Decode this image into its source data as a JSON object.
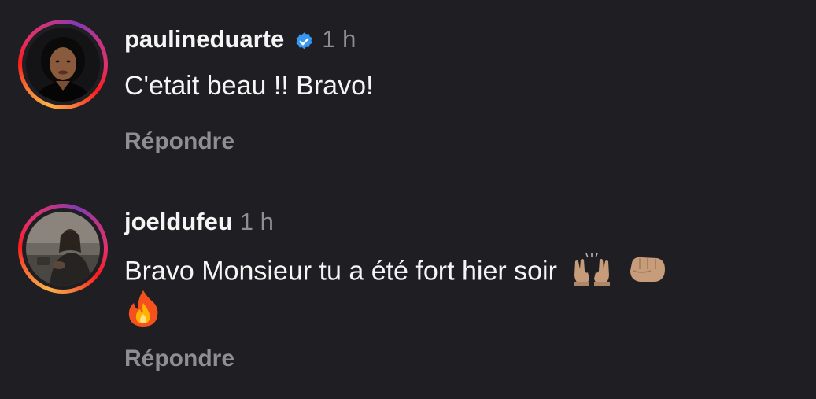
{
  "comments": [
    {
      "username": "paulineduarte",
      "verified": true,
      "time": "1 h",
      "text": "C'etait beau !! Bravo!",
      "reply_label": "Répondre",
      "avatar_icon": "profile-photo-woman"
    },
    {
      "username": "joeldufeu",
      "verified": false,
      "time": "1 h",
      "text": "Bravo Monsieur tu a été fort hier soir",
      "emojis": [
        "raising-hands-emoji",
        "oncoming-fist-emoji",
        "fire-emoji"
      ],
      "reply_label": "Répondre",
      "avatar_icon": "profile-photo-man"
    }
  ],
  "colors": {
    "background": "#1f1f23",
    "primary_text": "#f5f5f5",
    "secondary_text": "#8e8e93",
    "verified_badge": "#3897f0"
  }
}
